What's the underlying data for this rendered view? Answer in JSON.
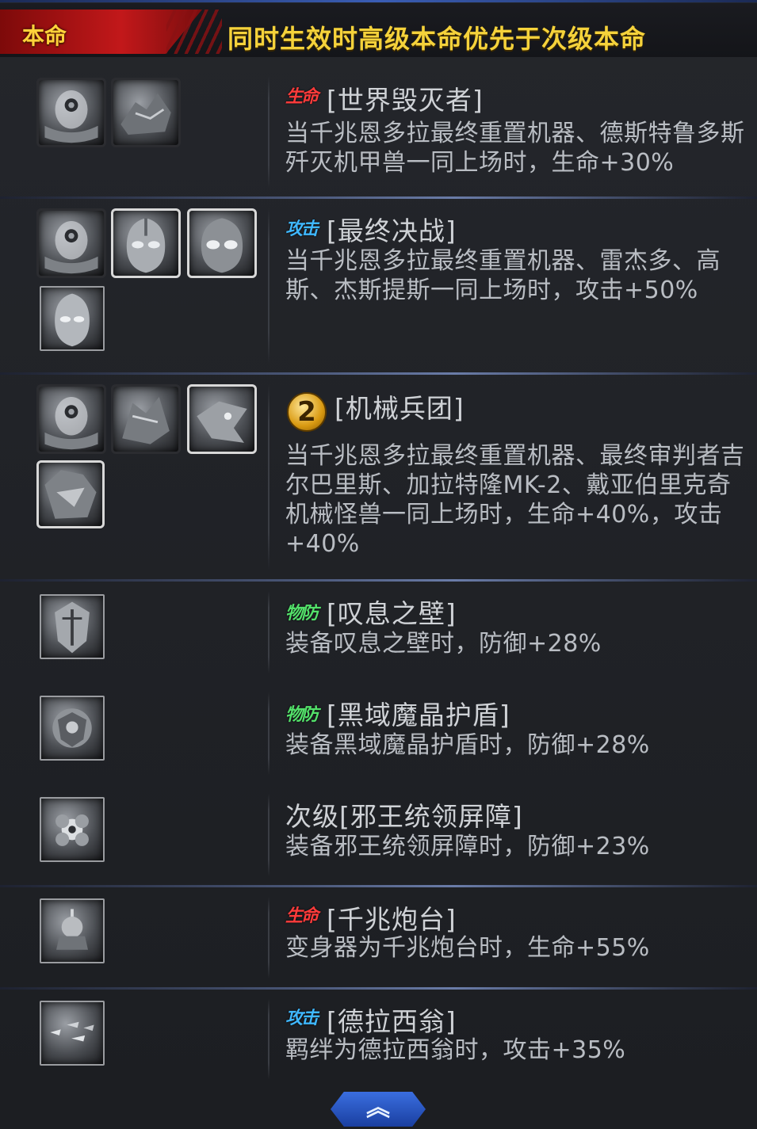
{
  "header": {
    "tag": "本命",
    "title": "同时生效时高级本命优先于次级本命"
  },
  "rows": [
    {
      "badge": "生命",
      "badge_type": "life",
      "name": "[世界毁灭者]",
      "desc": "当千兆恩多拉最终重置机器、德斯特鲁多斯歼灭机甲兽一同上场时，生命+30%",
      "icons": [
        "egg-robot-icon",
        "monster-icon"
      ]
    },
    {
      "badge": "攻击",
      "badge_type": "atk",
      "name": "[最终决战]",
      "desc": "当千兆恩多拉最终重置机器、雷杰多、高斯、杰斯提斯一同上场时，攻击+50%",
      "icons": [
        "egg-robot-icon",
        "ultraman-icon",
        "ultraman-icon",
        "ultraman-icon"
      ]
    },
    {
      "badge": "2",
      "badge_type": "level",
      "name": "[机械兵团]",
      "desc": "当千兆恩多拉最终重置机器、最终审判者吉尔巴里斯、加拉特隆MK-2、戴亚伯里克奇机械怪兽一同上场时，生命+40%，攻击+40%",
      "icons": [
        "egg-robot-icon",
        "monster-icon",
        "monster-icon",
        "monster-icon"
      ]
    },
    {
      "badge": "物防",
      "badge_type": "def",
      "name": "[叹息之壁]",
      "desc": "装备叹息之壁时，防御+28%",
      "icons": [
        "shield-icon"
      ]
    },
    {
      "badge": "物防",
      "badge_type": "def",
      "name": "[黑域魔晶护盾]",
      "desc": "装备黑域魔晶护盾时，防御+28%",
      "icons": [
        "shield-icon"
      ]
    },
    {
      "badge": "",
      "badge_type": "none",
      "name": "次级[邪王统领屏障]",
      "desc": "装备邪王统领屏障时，防御+23%",
      "icons": [
        "flower-shield-icon"
      ]
    },
    {
      "badge": "生命",
      "badge_type": "life",
      "name": "[千兆炮台]",
      "desc": "变身器为千兆炮台时，生命+55%",
      "icons": [
        "turret-icon"
      ]
    },
    {
      "badge": "攻击",
      "badge_type": "atk",
      "name": "[德拉西翁]",
      "desc": "羁绊为德拉西翁时，攻击+35%",
      "icons": [
        "fleet-icon"
      ]
    }
  ],
  "footer": {
    "collapse_label": "︽"
  }
}
